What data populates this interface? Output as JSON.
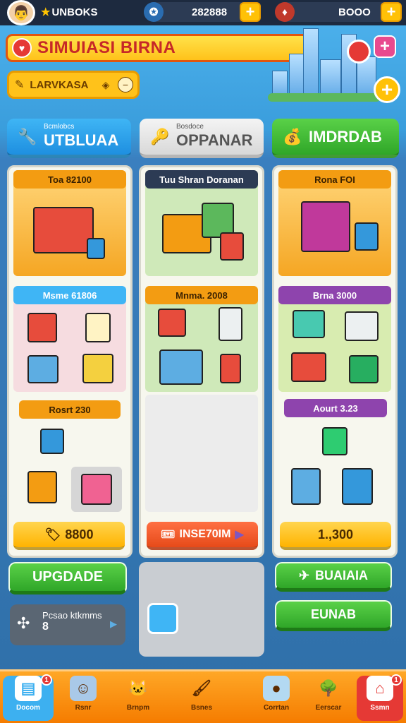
{
  "topbar": {
    "resource_name": "UNBOKS",
    "coins_value": "282888",
    "gems_value": "BOOO",
    "avatar_icon": "player-avatar"
  },
  "header": {
    "title": "SIMUIASI BIRNA",
    "search_label": "LARVKASA"
  },
  "tabs": [
    {
      "sub": "Bcmlobcs",
      "label": "UTBLUAA"
    },
    {
      "sub": "Bosdoce",
      "label": "OPPANAR"
    },
    {
      "sub": "",
      "label": "IMDRDAB"
    }
  ],
  "columns": [
    {
      "cards": [
        {
          "title": "Toa 82100",
          "color": "#f5a623"
        },
        {
          "title": "Msme 61806",
          "color": "#3fb5f5"
        },
        {
          "title": "Rosrt 230",
          "color": "#f5a623"
        }
      ],
      "price": "8800",
      "button": "UPGDADE",
      "hint_text": "Pcsao ktkmms",
      "hint_count": "8"
    },
    {
      "cards": [
        {
          "title": "Tuu Shran Doranan",
          "color": "#2c3b54"
        },
        {
          "title": "Mnma. 2008",
          "color": "#f5a623"
        }
      ],
      "price": "INSE70IM"
    },
    {
      "cards": [
        {
          "title": "Rona FOI",
          "color": "#f5a623"
        },
        {
          "title": "Brna 3000",
          "color": "#8e44ad"
        },
        {
          "title": "Aourt 3.23",
          "color": "#8e44ad"
        }
      ],
      "price": "1.,300",
      "button1": "BUAIAIA",
      "button2": "EUNAB"
    }
  ],
  "nav": [
    {
      "label": "Docom",
      "icon": "document-icon",
      "badge": "1"
    },
    {
      "label": "Rsnr",
      "icon": "person-icon"
    },
    {
      "label": "Brnpm",
      "icon": "cat-icon"
    },
    {
      "label": "Bsnes",
      "icon": "paint-icon"
    },
    {
      "label": "Corrtan",
      "icon": "coin-icon"
    },
    {
      "label": "Eerscar",
      "icon": "bush-icon"
    },
    {
      "label": "Ssmn",
      "icon": "shop-icon",
      "badge": "1"
    }
  ]
}
